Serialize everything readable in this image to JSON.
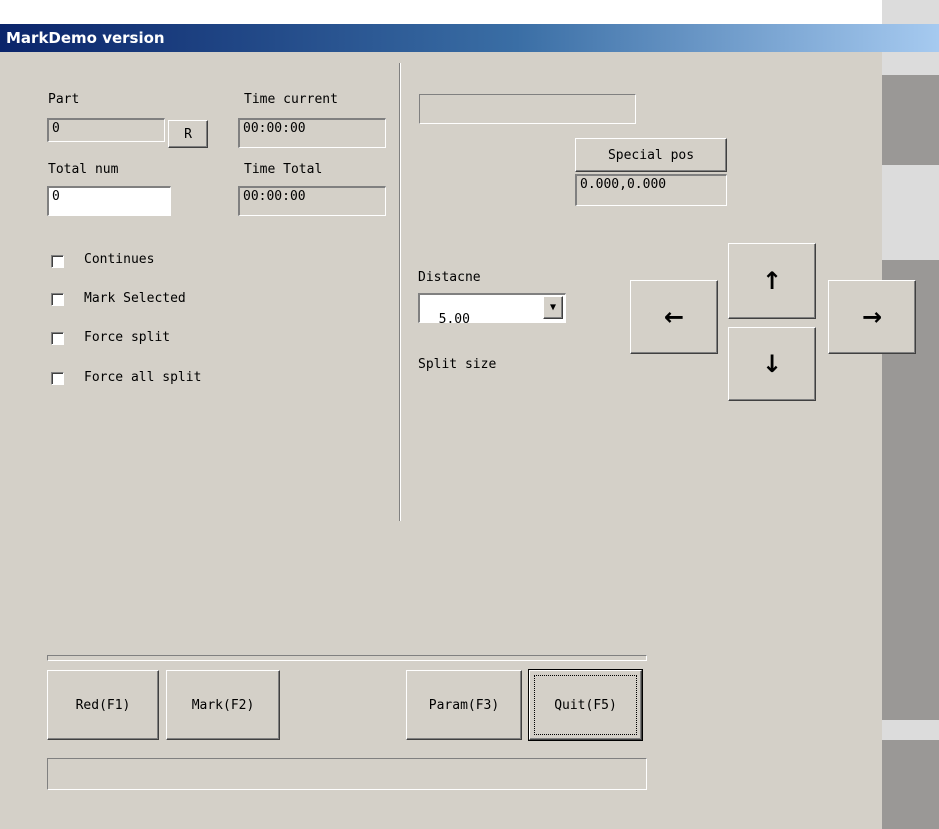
{
  "window": {
    "title": "MarkDemo version"
  },
  "left": {
    "part_label": "Part",
    "part_value": "0",
    "reset_button": "R",
    "time_current_label": "Time current",
    "time_current_value": "00:00:00",
    "total_num_label": "Total num",
    "total_num_value": "0",
    "time_total_label": "Time Total",
    "time_total_value": "00:00:00",
    "checkboxes": [
      {
        "label": "Continues",
        "checked": false
      },
      {
        "label": "Mark Selected",
        "checked": false
      },
      {
        "label": "Force split",
        "checked": false
      },
      {
        "label": "Force all split",
        "checked": false
      }
    ]
  },
  "right": {
    "status_value": "",
    "special_pos_button": "Special pos",
    "position_value": "0.000,0.000",
    "distance_label": "Distacne",
    "distance_value": "5.00",
    "split_size_label": "Split size",
    "arrows": {
      "up": "↑",
      "down": "↓",
      "left": "←",
      "right": "→"
    }
  },
  "bottom": {
    "progress": 0,
    "buttons": {
      "red": "Red(F1)",
      "mark": "Mark(F2)",
      "param": "Param(F3)",
      "quit": "Quit(F5)"
    },
    "status_text": ""
  },
  "colors": {
    "dialog_bg": "#d4d0c8",
    "titlebar_start": "#0a246a",
    "titlebar_end": "#a6caf0"
  }
}
